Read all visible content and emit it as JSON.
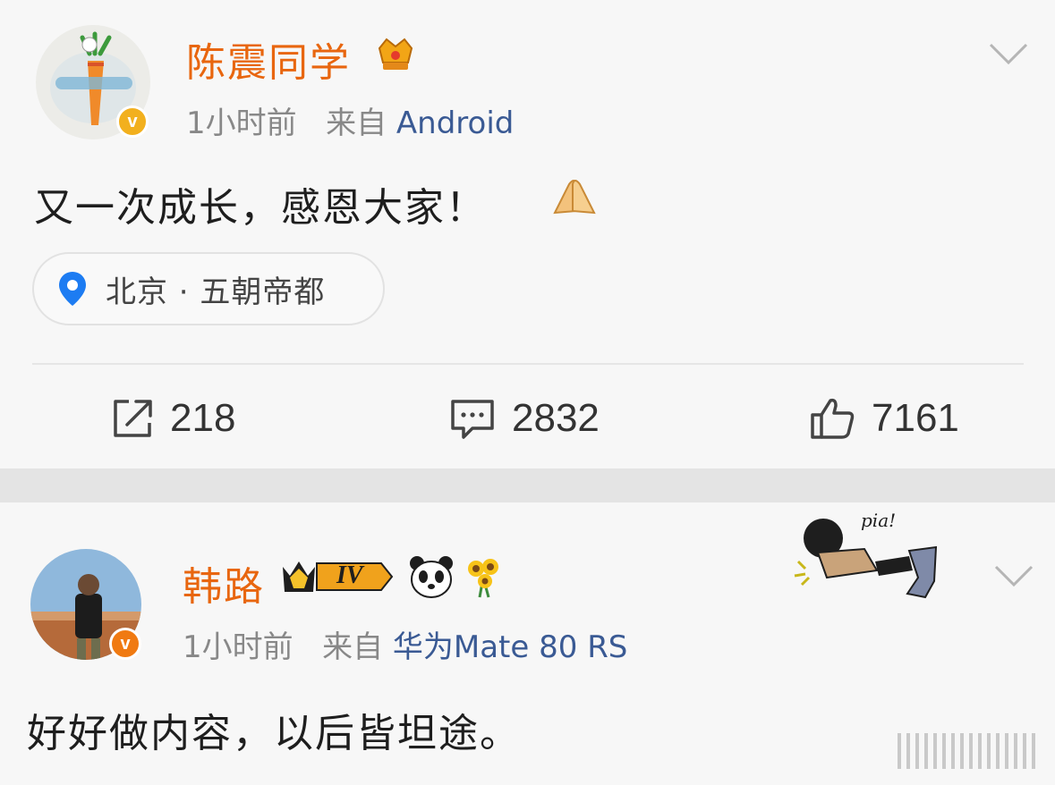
{
  "post": {
    "author": "陈震同学",
    "time": "1小时前",
    "source_prefix": "来自",
    "source": "Android",
    "text": "又一次成长，感恩大家！",
    "location": "北京 · 五朝帝都",
    "actions": {
      "reposts": "218",
      "comments": "2832",
      "likes": "7161"
    }
  },
  "comment": {
    "author": "韩路",
    "level_badge": "IV",
    "time": "1小时前",
    "source_prefix": "来自",
    "source": "华为Mate 80 RS",
    "text": "好好做内容，以后皆坦途。",
    "sticker_text": "pia!"
  },
  "colors": {
    "author_name": "#e8660f",
    "source_link": "#3a5a94",
    "verified_gold": "#f2b01e",
    "verified_orange": "#f07a12",
    "location_pin": "#1d7cf2"
  }
}
